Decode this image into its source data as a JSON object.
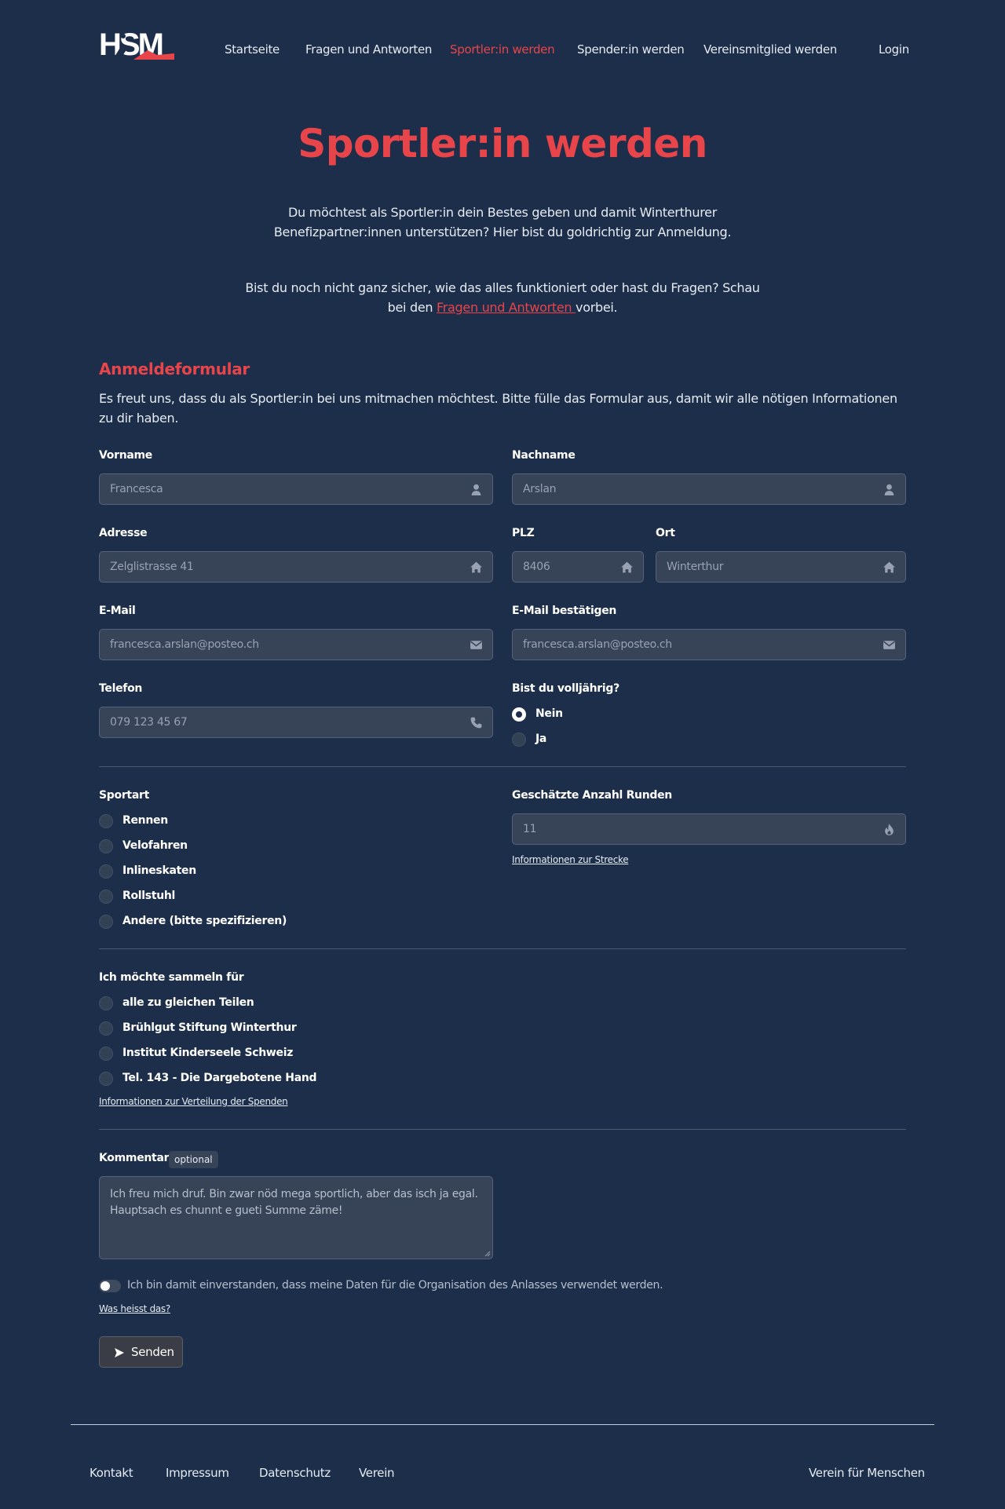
{
  "nav": {
    "logo_text": "HSM",
    "items": [
      {
        "label": "Startseite"
      },
      {
        "label": "Fragen und Antworten"
      },
      {
        "label": "Sportler:in werden"
      },
      {
        "label": "Spender:in werden"
      },
      {
        "label": "Vereinsmitglied werden"
      }
    ],
    "login": "Login",
    "active_color": "#e8454a"
  },
  "hero": {
    "title": "Sportler:in werden",
    "p1": "Du möchtest als Sportler:in dein Bestes geben und damit Winterthurer Benefizpartner:innen unterstützen? Hier bist du goldrichtig zur Anmeldung.",
    "p2_before": "Bist du noch nicht ganz sicher, wie das alles funktioniert oder hast du Fragen? Schau bei den ",
    "p2_link": "Fragen und Antworten ",
    "p2_after": "vorbei."
  },
  "form": {
    "title": "Anmeldeformular",
    "intro": "Es freut uns, dass du als Sportler:in bei uns mitmachen möchtest. Bitte fülle das Formular aus, damit wir alle nötigen Informationen zu dir haben.",
    "vorname": {
      "label": "Vorname",
      "value": "Francesca",
      "icon": "user-icon"
    },
    "nachname": {
      "label": "Nachname",
      "value": "Arslan",
      "icon": "user-icon"
    },
    "adresse": {
      "label": "Adresse",
      "value": "Zelglistrasse 41",
      "icon": "home-icon"
    },
    "plz": {
      "label": "PLZ",
      "value": "8406",
      "icon": "home-icon"
    },
    "ort": {
      "label": "Ort",
      "value": "Winterthur",
      "icon": "home-icon"
    },
    "email": {
      "label": "E-Mail",
      "value": "francesca.arslan@posteo.ch",
      "icon": "envelope-icon"
    },
    "email_confirm": {
      "label": "E-Mail bestätigen",
      "value": "francesca.arslan@posteo.ch",
      "icon": "envelope-icon"
    },
    "telefon": {
      "label": "Telefon",
      "value": "079 123 45 67",
      "icon": "phone-icon"
    },
    "volljaehrig": {
      "label": "Bist du volljährig?",
      "options": [
        "Nein",
        "Ja"
      ],
      "selected": "Nein"
    },
    "sportart": {
      "label": "Sportart",
      "options": [
        "Rennen",
        "Velofahren",
        "Inlineskaten",
        "Rollstuhl",
        "Andere (bitte spezifizieren)"
      ]
    },
    "runden": {
      "label": "Geschätzte Anzahl Runden",
      "value": "11",
      "icon": "fire-icon",
      "link": "Informationen zur Strecke"
    },
    "sammeln": {
      "label": "Ich möchte sammeln für",
      "options": [
        "alle zu gleichen Teilen",
        "Brühlgut Stiftung Winterthur",
        "Institut Kinderseele Schweiz",
        "Tel. 143 - Die Dargebotene Hand"
      ],
      "link": "Informationen zur Verteilung der Spenden"
    },
    "kommentar": {
      "label": "Kommentar",
      "badge": "optional",
      "value": "Ich freu mich druf. Bin zwar nöd mega sportlich, aber das isch ja egal. Hauptsach es chunnt e gueti Summe zäme!"
    },
    "consent": {
      "text": "Ich bin damit einverstanden, dass meine Daten für die Organisation des Anlasses verwendet werden.",
      "link": "Was heisst das?"
    },
    "submit": "Senden"
  },
  "footer": {
    "items": [
      "Kontakt",
      "Impressum",
      "Datenschutz",
      "Verein"
    ],
    "right": "Verein für Menschen"
  }
}
